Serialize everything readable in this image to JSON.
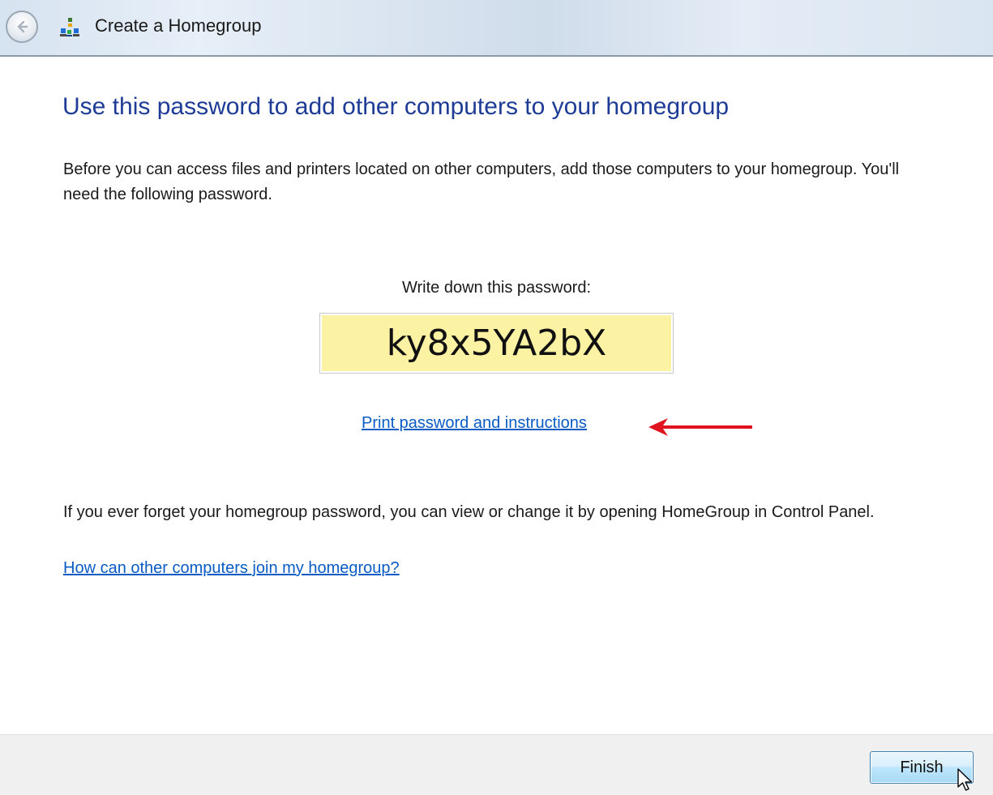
{
  "window": {
    "title": "Create a Homegroup",
    "back_icon": "back-arrow-icon",
    "app_icon": "homegroup-icon"
  },
  "main": {
    "heading": "Use this password to add other computers to your homegroup",
    "intro": "Before you can access files and printers located on other computers, add those computers to your homegroup. You'll need the following password.",
    "password_label": "Write down this password:",
    "password": "ky8x5YA2bX",
    "print_link": "Print password and instructions",
    "forget_text": "If you ever forget your homegroup password, you can view or change it by opening HomeGroup in Control Panel.",
    "join_link": "How can other computers join my homegroup?"
  },
  "footer": {
    "finish_label": "Finish"
  },
  "colors": {
    "heading": "#1e3c96",
    "link": "#0a5bc4",
    "password_bg": "#fcf2a4",
    "annotation_arrow": "#e0141e"
  }
}
